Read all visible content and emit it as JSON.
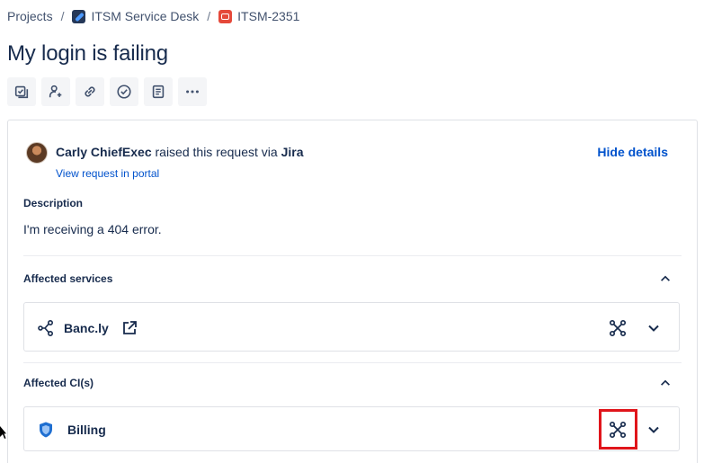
{
  "breadcrumb": {
    "root": "Projects",
    "project": "ITSM Service Desk",
    "issue_key": "ITSM-2351",
    "separator": "/"
  },
  "issue": {
    "title": "My login is failing"
  },
  "toolbar": {
    "buttons": [
      "checklist-icon",
      "assign-user-icon",
      "link-icon",
      "check-circle-icon",
      "document-icon",
      "more-icon"
    ]
  },
  "request": {
    "reporter": "Carly ChiefExec",
    "raised_text": " raised this request via ",
    "channel": "Jira",
    "portal_link": "View request in portal",
    "hide_details": "Hide details"
  },
  "description": {
    "label": "Description",
    "text": "I'm receiving a 404 error."
  },
  "affected_services": {
    "label": "Affected services",
    "items": [
      {
        "name": "Banc.ly",
        "icon": "service-graph-icon"
      }
    ]
  },
  "affected_cis": {
    "label": "Affected CI(s)",
    "items": [
      {
        "name": "Billing",
        "icon": "shield-icon"
      }
    ]
  },
  "colors": {
    "link": "#0052cc",
    "text": "#172b4d",
    "highlight": "#e0151b"
  }
}
